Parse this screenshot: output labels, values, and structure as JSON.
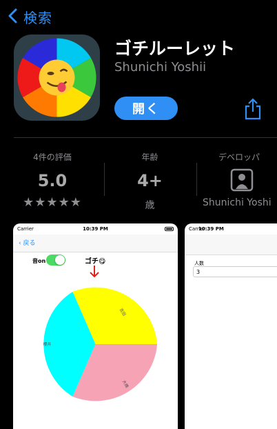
{
  "nav": {
    "back_label": "検索"
  },
  "app": {
    "title": "ゴチルーレット",
    "developer": "Shunichi Yoshii",
    "open_button": "開く"
  },
  "stats": {
    "ratings_label": "4件の評価",
    "rating_value": "5.0",
    "stars": "★★★★★",
    "age_label": "年齢",
    "age_value": "4+",
    "age_unit": "歳",
    "dev_label": "デベロッパ",
    "dev_name": "Shunichi Yoshi"
  },
  "screenshot1": {
    "carrier": "Carrier",
    "time": "10:39 PM",
    "back": "戻る",
    "sound_label": "音on",
    "gochi_label": "ゴチ😋",
    "segment_labels": [
      "吉田",
      "櫻井",
      "大橋"
    ],
    "wheel_colors": {
      "yellow": "#ffff00",
      "cyan": "#00ffff",
      "pink": "#f7a3b6"
    }
  },
  "screenshot2": {
    "carrier": "Carrier",
    "time": "10:39 PM",
    "people_label": "人数",
    "people_value": "3"
  },
  "colors": {
    "accent": "#2f8ff5"
  }
}
